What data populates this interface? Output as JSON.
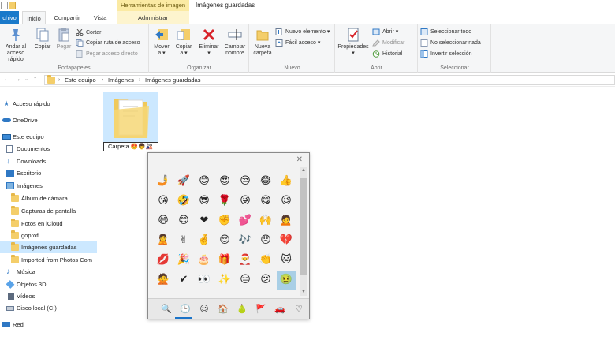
{
  "window": {
    "context_tab_label": "Herramientas de imagen",
    "title": "Imágenes guardadas"
  },
  "tabs": [
    {
      "label": "chivo"
    },
    {
      "label": "Inicio"
    },
    {
      "label": "Compartir"
    },
    {
      "label": "Vista"
    },
    {
      "label": "Administrar"
    }
  ],
  "ribbon": {
    "portapapeles": {
      "label": "Portapapeles",
      "anclar": "Anclar al acceso rápido",
      "anclar_l1": "Andar al",
      "anclar_l2": "acceso rápido",
      "copiar": "Copiar",
      "pegar": "Pegar",
      "cortar": "Cortar",
      "copiar_ruta": "Copiar ruta de acceso",
      "pegar_acceso": "Pegar acceso directo"
    },
    "organizar": {
      "label": "Organizar",
      "mover_l1": "Mover",
      "mover_l2": "a ▾",
      "copiar_l1": "Copiar",
      "copiar_l2": "a ▾",
      "eliminar_l1": "Eliminar",
      "eliminar_l2": "▾",
      "cambiar_l1": "Cambiar",
      "cambiar_l2": "nombre"
    },
    "nuevo": {
      "label": "Nuevo",
      "carpeta_l1": "Nueva",
      "carpeta_l2": "carpeta",
      "elemento": "Nuevo elemento ▾",
      "facil": "Fácil acceso ▾"
    },
    "abrir": {
      "label": "Abrir",
      "propiedades_l1": "Propiedades",
      "propiedades_l2": "▾",
      "abrir": "Abrir ▾",
      "modificar": "Modificar",
      "historial": "Historial"
    },
    "seleccionar": {
      "label": "Seleccionar",
      "todo": "Seleccionar todo",
      "nada": "No seleccionar nada",
      "invertir": "Invertir selección"
    }
  },
  "address": {
    "crumbs": [
      "Este equipo",
      "Imágenes",
      "Imágenes guardadas"
    ]
  },
  "nav": {
    "acceso_rapido": "Acceso rápido",
    "onedrive": "OneDrive",
    "este_equipo": "Este equipo",
    "documentos": "Documentos",
    "downloads": "Downloads",
    "escritorio": "Escritorio",
    "imagenes": "Imágenes",
    "album": "Álbum de cámara",
    "capturas": "Capturas de pantalla",
    "icloud": "Fotos en iCloud",
    "goprofi": "goprofi",
    "guardadas": "Imágenes guardadas",
    "imported": "Imported from Photos Com",
    "musica": "Música",
    "objetos": "Objetos 3D",
    "videos": "Vídeos",
    "disco": "Disco local (C:)",
    "red": "Red"
  },
  "content": {
    "rename_value": "Carpeta 😍👦🎎"
  },
  "emoji_panel": {
    "close": "✕",
    "rows": [
      [
        "🤳",
        "🚀",
        "😊",
        "😍",
        "😒",
        "😂",
        "👍"
      ],
      [
        "😘",
        "🤣",
        "😎",
        "🌹",
        "😜",
        "😋",
        "😉"
      ],
      [
        "😄",
        "😊",
        "❤",
        "✊",
        "💕",
        "🙌",
        "🙍"
      ],
      [
        "🙎",
        "✌",
        "🤞",
        "😌",
        "🎶",
        "😞",
        "💔"
      ],
      [
        "💋",
        "🎉",
        "🎂",
        "🎁",
        "🎅",
        "👏",
        "🐱"
      ],
      [
        "🙅",
        "✔",
        "👀",
        "✨",
        "😑",
        "😕",
        "🤢"
      ]
    ],
    "categories": [
      "🔍",
      "🕒",
      "☺",
      "🏠",
      "🍐",
      "🚩",
      "🚗",
      "♡"
    ]
  },
  "colors": {
    "file_tab": "#1979ca",
    "selection": "#cce8ff",
    "context_tab": "#fbeaa3",
    "emoji_selected": "#a9cfe6",
    "category_underline": "#1a73c8"
  }
}
